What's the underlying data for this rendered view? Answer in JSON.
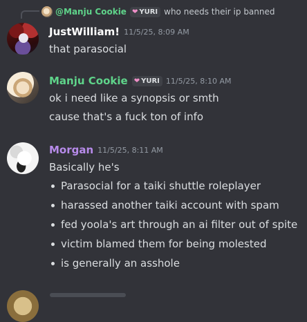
{
  "reply": {
    "avatar_icon": "manju-cookie-avatar-icon",
    "name": "@Manju Cookie",
    "tag": "YURI",
    "text": "who needs their ip banned"
  },
  "messages": [
    {
      "author": "JustWilliam!",
      "author_color": "#ffffff",
      "timestamp": "11/5/25, 8:09 AM",
      "lines": [
        "that parasocial"
      ]
    },
    {
      "author": "Manju Cookie",
      "author_color": "#5fd48a",
      "tag": "YURI",
      "timestamp": "11/5/25, 8:10 AM",
      "lines": [
        "ok i need like a synopsis or smth",
        "cause that's a fuck ton of info"
      ]
    },
    {
      "author": "Morgan",
      "author_color": "#b78bea",
      "timestamp": "11/5/25, 8:11 AM",
      "lines": [
        "Basically he's"
      ],
      "bullets": [
        "Parasocial for a taiki shuttle roleplayer",
        "harassed another taiki account with spam",
        "fed yoola's art through an ai filter out of spite",
        "victim blamed them for being molested",
        "is generally an asshole"
      ]
    }
  ],
  "tag_heart_icon": "pink-heart-icon"
}
